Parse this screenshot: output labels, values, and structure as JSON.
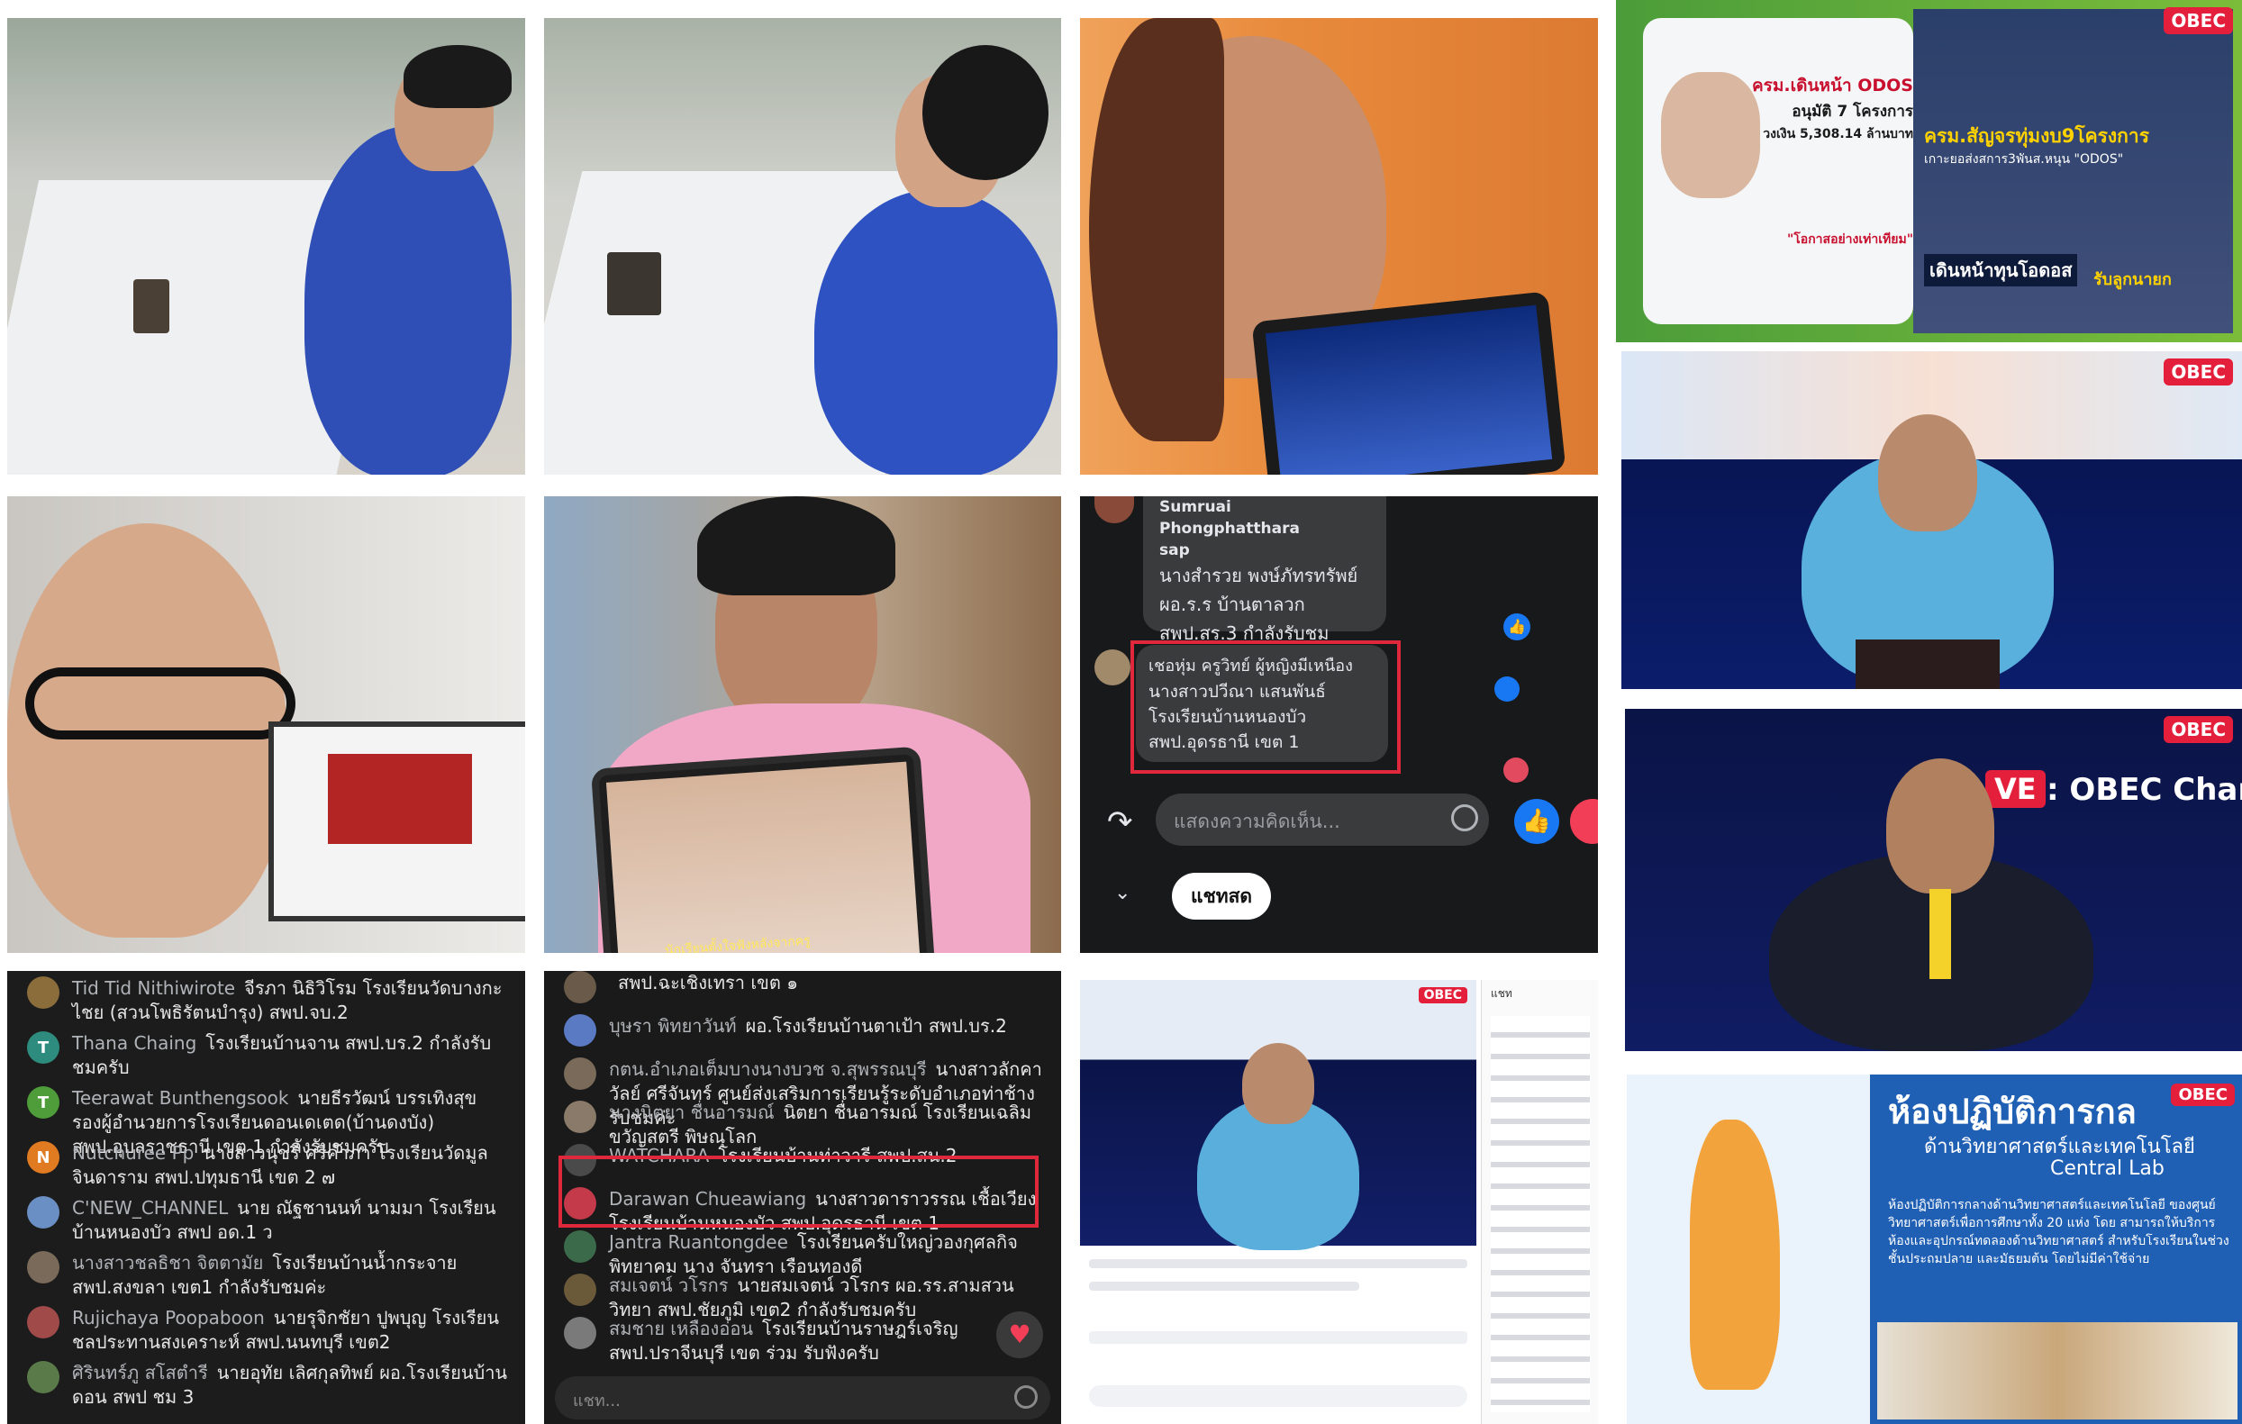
{
  "tiles": {
    "teacher_desk_1": {
      "caption": ""
    },
    "teacher_desk_2": {
      "caption": ""
    },
    "teacher_selfie_tablet": {
      "caption": ""
    },
    "news_graphic": {
      "headline_1": "ครม.เดินหน้า ODOS",
      "headline_2": "อนุมัติ 7 โครงการ",
      "headline_3": "วงเงิน 5,308.14 ล้านบาท",
      "headline_4": "\"โอกาสอย่างเท่าเทียม\"",
      "banner": "ครม.สัญจรทุ่มงบ9โครงการ",
      "sub_banner": "เกาะยอส่งสการ3พันส.หนุน \"ODOS\"",
      "ticker_1": "เดินหน้าทุนโอดอส",
      "ticker_2": "รับลูกนายก",
      "obec": "OBEC"
    },
    "selfie_laptop": {
      "caption": ""
    },
    "selfie_tablet": {
      "tablet_caption": "นักเรียนตั้งใจฟังหลังจากครู"
    },
    "fb_comments": {
      "comment_1_name": "Sumruai Phongphatthara sap",
      "comment_1_lines": [
        "นางสำรวย พงษ์ภัทรทรัพย์",
        "ผอ.ร.ร บ้านตาลวก",
        "สพป.สร.3 กำลังรับชม"
      ],
      "comment_2_lines": [
        "เชอหุ่ม ครูวิทย์ ผู้หญิงมีเหนือง",
        "นางสาวปวีณา แสนพันธ์",
        "โรงเรียนบ้านหนองบัว",
        "สพป.อุดรธานี เขต 1"
      ],
      "input_placeholder": "แสดงความคิดเห็น...",
      "chat_button": "แชทสด"
    },
    "obec_stage_1": {
      "obec": "OBEC"
    },
    "obec_stage_2": {
      "live": "VE",
      "channel": ": OBEC Char",
      "obec": "OBEC"
    },
    "live_chat_1": {
      "rows": [
        {
          "name": "Tid Tid Nithiwirote",
          "text": "จีรภา นิธิวิโรม โรงเรียนวัดบางกะไชย (สวนโพธิรัตนบำรุง) สพป.จบ.2",
          "initial": "",
          "color": "#8a6d3b"
        },
        {
          "name": "Thana Chaing",
          "text": "โรงเรียนบ้านจาน สพป.บร.2 กำลังรับชมครับ",
          "initial": "T",
          "color": "#2e8c7e"
        },
        {
          "name": "Teerawat Bunthengsook",
          "text": "นายธีรวัฒน์ บรรเทิงสุข รองผู้อำนวยการโรงเรียนดอนเดเตด(บ้านดงบัง) สพป.อุบลราชธานี เขต 1 กำลังรับชมครับ",
          "initial": "T",
          "color": "#4f9d3a"
        },
        {
          "name": "Nutchuree Pp",
          "text": "นางสาวนุชรี ศรีคำภา โรงเรียนวัดมูลจินดาราม สพป.ปทุมธานี เขต 2 ๗",
          "initial": "N",
          "color": "#e07b22"
        },
        {
          "name": "C'NEW_CHANNEL",
          "text": "นาย ณัฐชานนท์ นามมา โรงเรียนบ้านหนองบัว สพป อด.1 ว",
          "initial": "",
          "color": "#6a8fc4"
        },
        {
          "name": "นางสาวชลธิชา จิตตามัย",
          "text": "โรงเรียนบ้านน้ำกระจาย สพป.สงขลา เขต1 กำลังรับชมค่ะ",
          "initial": "",
          "color": "#7a6a5a"
        },
        {
          "name": "Rujichaya Poopaboon",
          "text": "นายรุจิกชัยา ปูพบุญ โรงเรียนชลประทานสงเคราะห์ สพป.นนทบุรี เขต2",
          "initial": "",
          "color": "#a04a4a"
        },
        {
          "name": "ศิรินทร์ภู สโสตำรี",
          "text": "นายอุทัย เลิศกุลทิพย์ ผอ.โรงเรียนบ้านดอน สพป ชม 3",
          "initial": "",
          "color": "#5a7a4a"
        }
      ]
    },
    "live_chat_2": {
      "rows": [
        {
          "name": "",
          "text": "สพป.ฉะเชิงเทรา เขต ๑",
          "color": "#6a5a4a"
        },
        {
          "name": "บุษรา พิทยาวันท์",
          "text": "ผอ.โรงเรียนบ้านตาเป้า สพป.บร.2",
          "color": "#5a7ac4"
        },
        {
          "name": "กตน.อำเภอเต็มบางนางบวช จ.สุพรรณบุรี",
          "text": "นางสาวลักคาวัลย์ ศรีจันทร์ ศูนย์ส่งเสริมการเรียนรู้ระดับอำเภอท่าช้าง รับชมค่ะ",
          "color": "#7a6a5a"
        },
        {
          "name": "นางนิตยา ชื่นอารมณ์",
          "text": "นิตยา ชื่นอารมณ์ โรงเรียนเฉลิมขวัญสตรี พิษณุโลก",
          "color": "#8a7a6a"
        },
        {
          "name": "WATCHARA",
          "text": "โรงเรียนบ้านท่าวารี สพป.สน.2",
          "color": "#4a4a4a"
        },
        {
          "name": "Darawan Chueawiang",
          "text": "นางสาวดาราวรรณ เชื้อเวียง โรงเรียนบ้านหนองบัว สพป.อุดรธานี เขต 1",
          "color": "#c43a4a"
        },
        {
          "name": "Jantra Ruantongdee",
          "text": "โรงเรียนครับใหญ่วองกุศลกิจพิทยาคม นาง จันทรา เรือนทองดี",
          "color": "#3a6a4a"
        },
        {
          "name": "สมเจตน์ วโรกร",
          "text": "นายสมเจตน์ วโรกร ผอ.รร.สามสวนวิทยา สพป.ชัยภูมิ เขต2 กำลังรับชมครับ",
          "color": "#6a5a3a"
        },
        {
          "name": "สมชาย เหลืองอ่อน",
          "text": "โรงเรียนบ้านราษฎร์เจริญ สพป.ปราจีนบุรี เขต ร่วม รับฟังครับ",
          "color": "#7a7a7a"
        }
      ],
      "input_placeholder": "แชท..."
    },
    "fb_live_screenshot": {
      "page_label": "แชท",
      "obec": "OBEC"
    },
    "central_lab": {
      "title": "ห้องปฏิบัติการกล",
      "subtitle": "ด้านวิทยาศาสตร์และเทคโนโลยี",
      "english": "Central Lab",
      "body": "ห้องปฏิบัติการกลางด้านวิทยาศาสตร์และเทคโนโลยี ของศูนย์วิทยาศาสตร์เพื่อการศึกษาทั้ง 20 แห่ง โดย สามารถให้บริการห้องและอุปกรณ์ทดลองด้านวิทยาศาสตร์ สำหรับโรงเรียนในช่วงชั้นประถมปลาย และมัธยมต้น โดยไม่มีค่าใช้จ่าย",
      "obec": "OBEC"
    }
  },
  "colors": {
    "fb_like": "#1877f2",
    "highlight": "#e0283c",
    "obec_red": "#e31f3b"
  }
}
